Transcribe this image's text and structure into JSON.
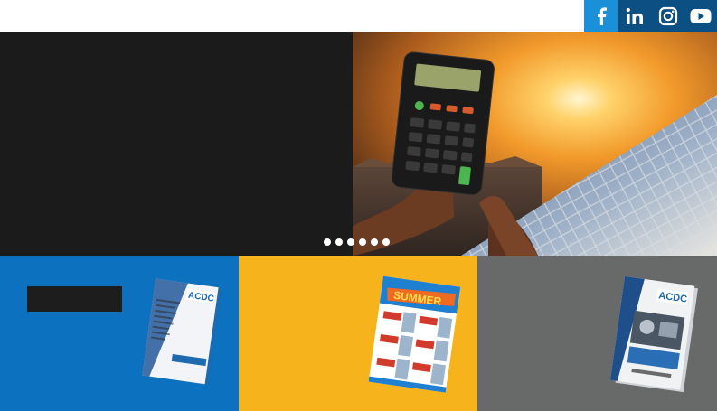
{
  "header": {
    "social": [
      {
        "name": "facebook",
        "icon": "facebook-icon",
        "color": "#1b8fd8"
      },
      {
        "name": "linkedin",
        "icon": "linkedin-icon",
        "color": "#0c4f82"
      },
      {
        "name": "instagram",
        "icon": "instagram-icon",
        "color": "#0c4f82"
      },
      {
        "name": "youtube",
        "icon": "youtube-icon",
        "color": "#0c4f82"
      }
    ]
  },
  "hero": {
    "left_color": "#1b1b1b",
    "slides_count": 6,
    "active_slide": 1
  },
  "catalog_brand": {
    "logo_text": "ACDC",
    "promo_word": "SUMMER"
  },
  "panels": {
    "blue": "#0c72bf",
    "yellow": "#f6b31b",
    "grey": "#676a69"
  }
}
